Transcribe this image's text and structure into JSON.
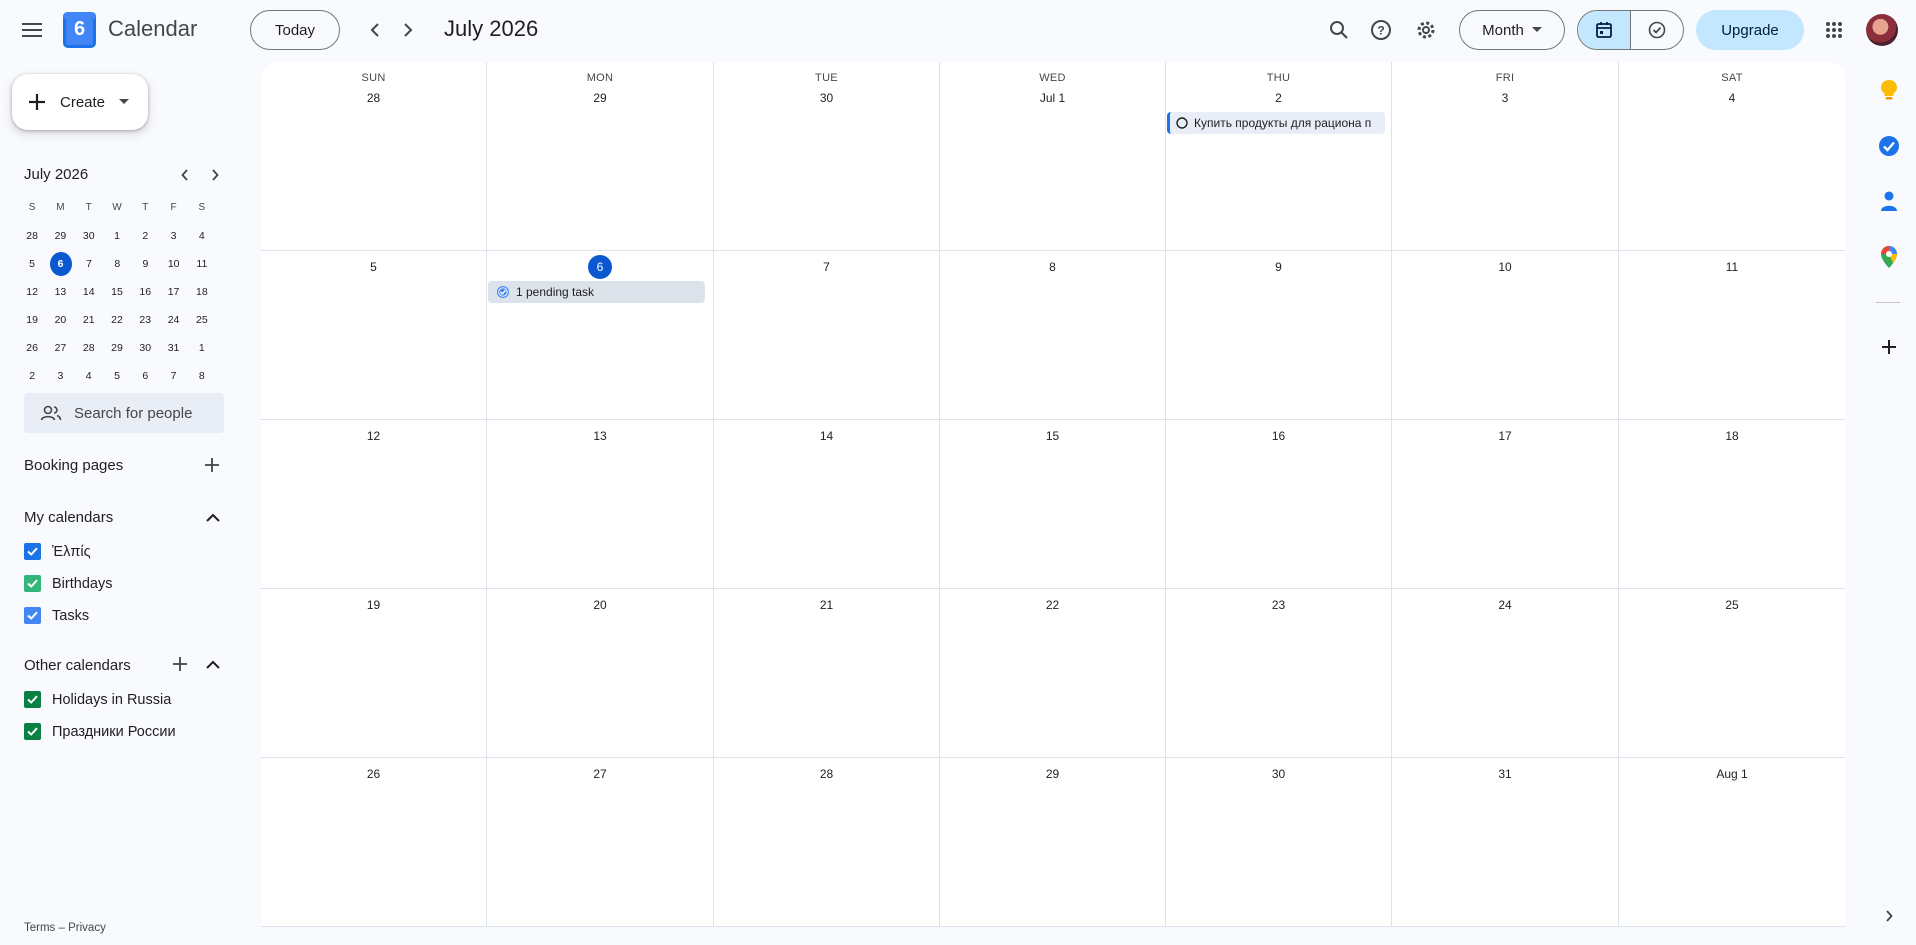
{
  "header": {
    "app_title": "Calendar",
    "logo_day": "6",
    "today_label": "Today",
    "period_title": "July 2026",
    "view_label": "Month",
    "upgrade_label": "Upgrade"
  },
  "sidebar": {
    "create_label": "Create",
    "mini_calendar": {
      "title": "July 2026",
      "dow": [
        "S",
        "M",
        "T",
        "W",
        "T",
        "F",
        "S"
      ],
      "weeks": [
        [
          "28",
          "29",
          "30",
          "1",
          "2",
          "3",
          "4"
        ],
        [
          "5",
          "6",
          "7",
          "8",
          "9",
          "10",
          "11"
        ],
        [
          "12",
          "13",
          "14",
          "15",
          "16",
          "17",
          "18"
        ],
        [
          "19",
          "20",
          "21",
          "22",
          "23",
          "24",
          "25"
        ],
        [
          "26",
          "27",
          "28",
          "29",
          "30",
          "31",
          "1"
        ],
        [
          "2",
          "3",
          "4",
          "5",
          "6",
          "7",
          "8"
        ]
      ],
      "today": "6"
    },
    "people_search_placeholder": "Search for people",
    "booking_pages_label": "Booking pages",
    "my_calendars_label": "My calendars",
    "my_calendars": [
      {
        "label": "Ἐλπίς",
        "color": "#1a73e8"
      },
      {
        "label": "Birthdays",
        "color": "#33b679"
      },
      {
        "label": "Tasks",
        "color": "#4285f4"
      }
    ],
    "other_calendars_label": "Other calendars",
    "other_calendars": [
      {
        "label": "Holidays in Russia",
        "color": "#0b8043"
      },
      {
        "label": "Праздники России",
        "color": "#0b8043"
      }
    ],
    "footer": {
      "terms": "Terms",
      "separator": "–",
      "privacy": "Privacy"
    }
  },
  "month": {
    "dow": [
      "SUN",
      "MON",
      "TUE",
      "WED",
      "THU",
      "FRI",
      "SAT"
    ],
    "weeks": [
      [
        "28",
        "29",
        "30",
        "Jul 1",
        "2",
        "3",
        "4"
      ],
      [
        "5",
        "6",
        "7",
        "8",
        "9",
        "10",
        "11"
      ],
      [
        "12",
        "13",
        "14",
        "15",
        "16",
        "17",
        "18"
      ],
      [
        "19",
        "20",
        "21",
        "22",
        "23",
        "24",
        "25"
      ],
      [
        "26",
        "27",
        "28",
        "29",
        "30",
        "31",
        "Aug 1"
      ]
    ],
    "today": {
      "week": 1,
      "day": 1
    },
    "events": {
      "thu_task": "Купить продукты для рациона п",
      "pending": "1 pending task"
    }
  },
  "colors": {
    "accent": "#0b57d0",
    "upgrade_bg": "#c2e7ff",
    "page_bg": "#f8fafd"
  },
  "icons": {
    "menu": "hamburger-icon",
    "search": "search-icon",
    "help": "help-icon",
    "settings": "gear-icon",
    "apps": "apps-grid-icon",
    "calendar_view": "calendar-icon",
    "tasks_view": "task-check-icon",
    "keep": "keep-bulb-icon",
    "tasks": "tasks-icon",
    "contacts": "contacts-icon",
    "maps": "maps-pin-icon",
    "add_addon": "plus-icon"
  }
}
